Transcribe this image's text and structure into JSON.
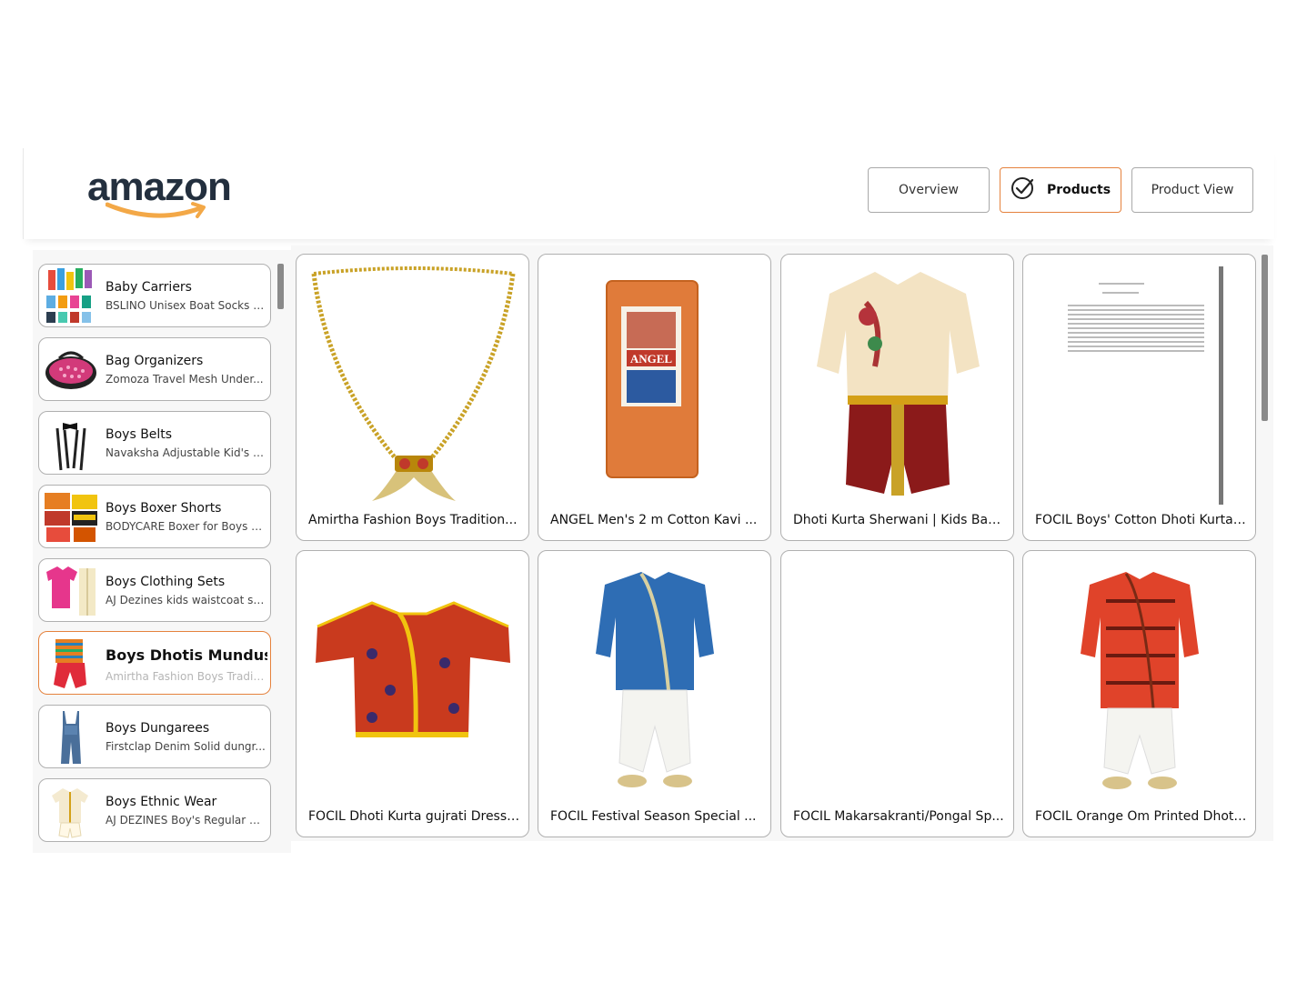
{
  "header": {
    "logo_text": "amazon",
    "tabs": [
      {
        "label": "Overview",
        "active": false
      },
      {
        "label": "Products",
        "active": true
      },
      {
        "label": "Product View",
        "active": false
      }
    ]
  },
  "colors": {
    "accent": "#e5823d",
    "logo_smile": "#f3a847",
    "card_border": "#b0b0b0"
  },
  "categories": [
    {
      "title": "Baby Carriers",
      "subtitle": "BSLINO Unisex Boat Socks a..."
    },
    {
      "title": "Bag Organizers",
      "subtitle": "Zomoza Travel Mesh Under..."
    },
    {
      "title": "Boys Belts",
      "subtitle": "Navaksha Adjustable Kid's S..."
    },
    {
      "title": "Boys Boxer Shorts",
      "subtitle": "BODYCARE Boxer for Boys P..."
    },
    {
      "title": "Boys Clothing Sets",
      "subtitle": "AJ Dezines kids waistcoat su..."
    },
    {
      "title": "Boys Dhotis Mundus",
      "subtitle": "Amirtha Fashion Boys Traditi...",
      "selected": true
    },
    {
      "title": "Boys Dungarees",
      "subtitle": "Firstclap Denim Solid dungr..."
    },
    {
      "title": "Boys Ethnic Wear",
      "subtitle": "AJ DEZINES Boy's Regular Fi..."
    }
  ],
  "products": [
    {
      "name": "Amirtha Fashion Boys Tradition...",
      "image": "gold-chain-pendant"
    },
    {
      "name": "ANGEL Men's 2 m Cotton Kavi ...",
      "image": "orange-dhoti-pack"
    },
    {
      "name": "Dhoti Kurta Sherwani | Kids Bab...",
      "image": "cream-sherwani-maroon-dhoti"
    },
    {
      "name": "FOCIL Boys' Cotton Dhoti Kurta ...",
      "image": "size-chart"
    },
    {
      "name": "FOCIL Dhoti Kurta gujrati Dress ...",
      "image": "red-printed-kurta"
    },
    {
      "name": "FOCIL Festival Season Special ...",
      "image": "blue-kurta-white-dhoti"
    },
    {
      "name": "FOCIL Makarsakranti/Pongal Sp...",
      "image": "blank"
    },
    {
      "name": "FOCIL Orange Om Printed Dhoti ...",
      "image": "orange-om-kurta"
    }
  ]
}
